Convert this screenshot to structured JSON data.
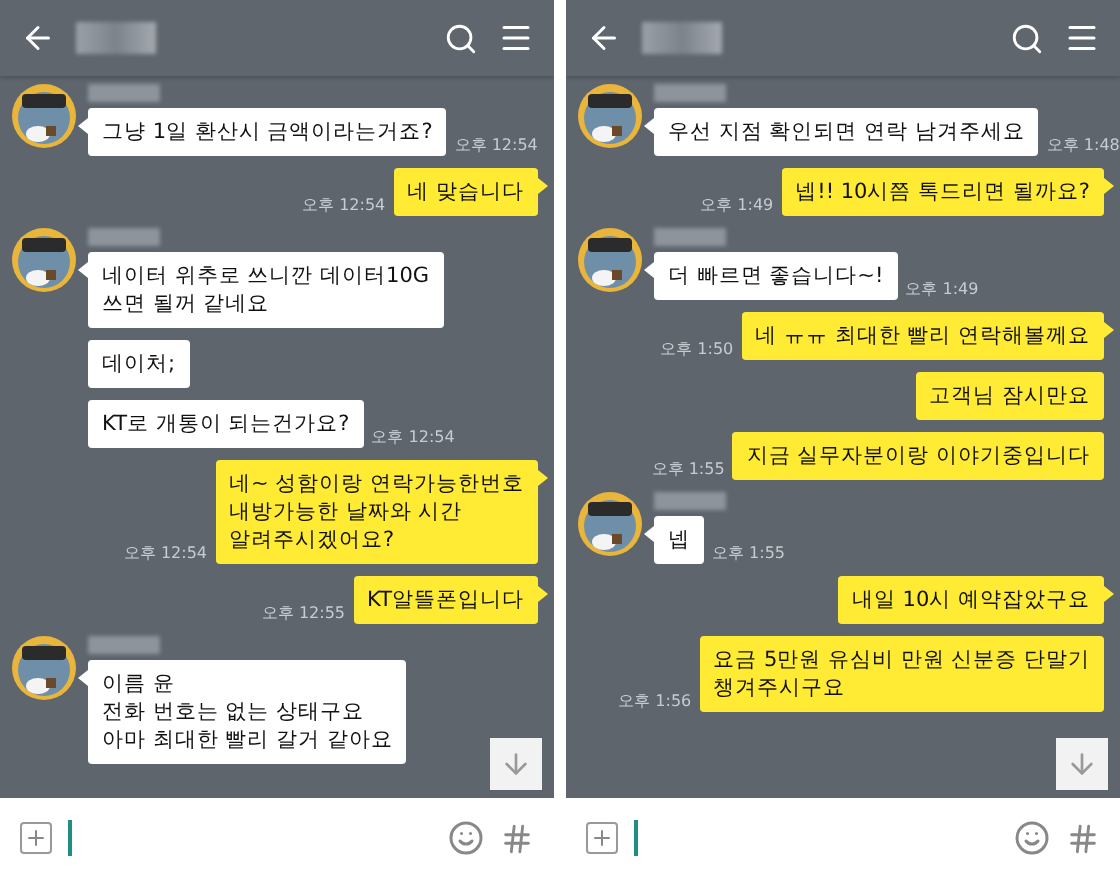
{
  "panels": [
    {
      "messages": [
        {
          "kind": "in",
          "first": true,
          "text": "그냥 1일 환산시 금액이라는거죠?",
          "time": "오후 12:54"
        },
        {
          "kind": "out",
          "first": true,
          "text": "네 맞습니다",
          "time": "오후 12:54"
        },
        {
          "kind": "in",
          "first": true,
          "text": "네이터 위추로 쓰니깐 데이터10G\n쓰면 될꺼 같네요"
        },
        {
          "kind": "in",
          "first": false,
          "text": "데이처;"
        },
        {
          "kind": "in",
          "first": false,
          "text": "KT로 개통이 되는건가요?",
          "time": "오후 12:54"
        },
        {
          "kind": "out",
          "first": true,
          "text": "네~ 성함이랑 연락가능한번호\n내방가능한 날짜와 시간\n알려주시겠어요?",
          "time": "오후 12:54"
        },
        {
          "kind": "out",
          "first": true,
          "text": "KT알뜰폰입니다",
          "time": "오후 12:55"
        },
        {
          "kind": "in",
          "first": true,
          "text": "이름 윤\n전화 번호는 없는 상태구요\n아마 최대한 빨리 갈거 같아요"
        }
      ]
    },
    {
      "messages": [
        {
          "kind": "in",
          "first": true,
          "text": "우선 지점 확인되면 연락 남겨주세요",
          "time": "오후 1:48"
        },
        {
          "kind": "out",
          "first": true,
          "text": "넵!! 10시쯤 톡드리면 될까요?",
          "time": "오후 1:49"
        },
        {
          "kind": "in",
          "first": true,
          "text": "더 빠르면 좋습니다~!",
          "time": "오후 1:49"
        },
        {
          "kind": "out",
          "first": true,
          "text": "네 ㅠㅠ 최대한 빨리 연락해볼께요",
          "time": "오후 1:50"
        },
        {
          "kind": "out",
          "first": false,
          "text": "고객님 잠시만요"
        },
        {
          "kind": "out",
          "first": false,
          "text": "지금 실무자분이랑 이야기중입니다",
          "time": "오후 1:55"
        },
        {
          "kind": "in",
          "first": true,
          "text": "넵",
          "time": "오후 1:55"
        },
        {
          "kind": "out",
          "first": true,
          "text": "내일 10시 예약잡았구요"
        },
        {
          "kind": "out",
          "first": false,
          "text": "요금 5만원 유심비 만원 신분증 단말기\n챙겨주시구요",
          "time": "오후 1:56"
        }
      ]
    }
  ]
}
